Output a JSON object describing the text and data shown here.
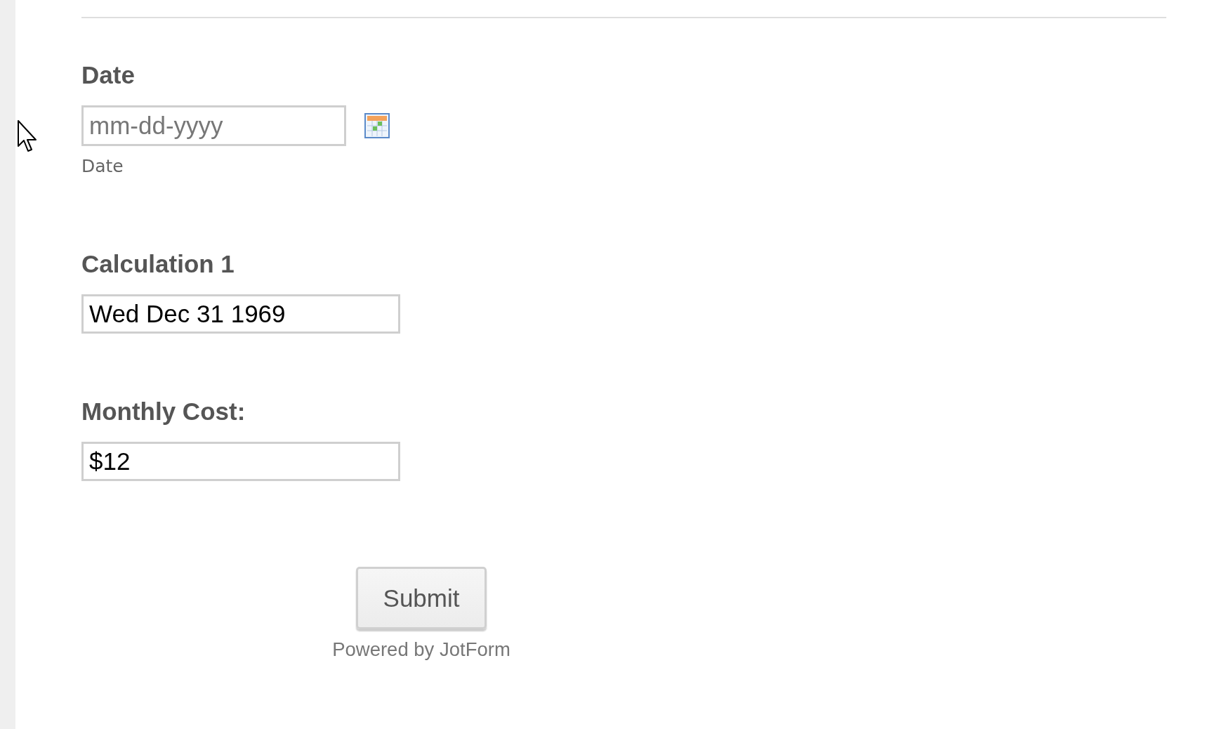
{
  "fields": [
    {
      "kind": "date",
      "label": "Date",
      "placeholder": "mm-dd-yyyy",
      "sublabel": "Date"
    },
    {
      "kind": "text",
      "label": "Calculation 1",
      "value": "Wed Dec 31 1969"
    },
    {
      "kind": "text",
      "label": "Monthly Cost:",
      "value": "$12"
    }
  ],
  "submit": {
    "label": "Submit"
  },
  "footer": "Powered by JotForm"
}
